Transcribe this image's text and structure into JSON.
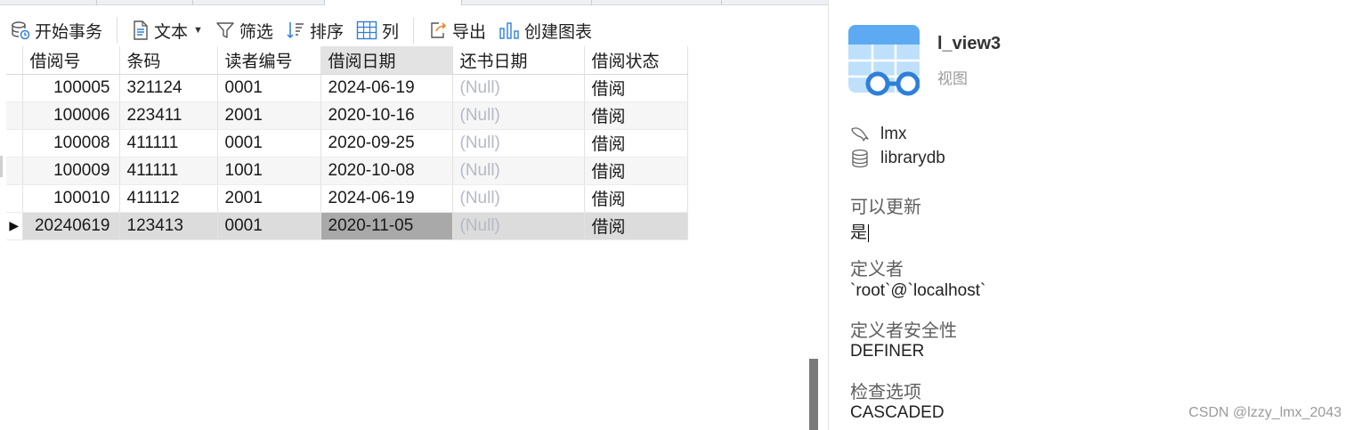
{
  "toolbar": {
    "begin_transaction": "开始事务",
    "text": "文本",
    "filter": "筛选",
    "sort": "排序",
    "columns": "列",
    "export": "导出",
    "create_chart": "创建图表"
  },
  "grid": {
    "columns": [
      "借阅号",
      "条码",
      "读者编号",
      "借阅日期",
      "还书日期",
      "借阅状态"
    ],
    "rows": [
      [
        "100005",
        "321124",
        "0001",
        "2024-06-19",
        "(Null)",
        "借阅"
      ],
      [
        "100006",
        "223411",
        "2001",
        "2020-10-16",
        "(Null)",
        "借阅"
      ],
      [
        "100008",
        "411111",
        "0001",
        "2020-09-25",
        "(Null)",
        "借阅"
      ],
      [
        "100009",
        "411111",
        "1001",
        "2020-10-08",
        "(Null)",
        "借阅"
      ],
      [
        "100010",
        "411112",
        "2001",
        "2024-06-19",
        "(Null)",
        "借阅"
      ],
      [
        "20240619",
        "123413",
        "0001",
        "2020-11-05",
        "(Null)",
        "借阅"
      ]
    ],
    "current_row_marker": "▶"
  },
  "info": {
    "object_name": "l_view3",
    "object_type": "视图",
    "connection": "lmx",
    "database": "librarydb",
    "properties": [
      {
        "label": "可以更新",
        "value": "是"
      },
      {
        "label": "定义者",
        "value": "`root`@`localhost`"
      },
      {
        "label": "定义者安全性",
        "value": "DEFINER"
      },
      {
        "label": "检查选项",
        "value": "CASCADED"
      }
    ]
  },
  "watermark": "CSDN @lzzy_lmx_2043",
  "colors": {
    "accent_blue": "#2f7fd8",
    "null_text": "#b4b9c4",
    "selected_row": "#dcdcdc",
    "active_cell": "#a9a9a9"
  }
}
